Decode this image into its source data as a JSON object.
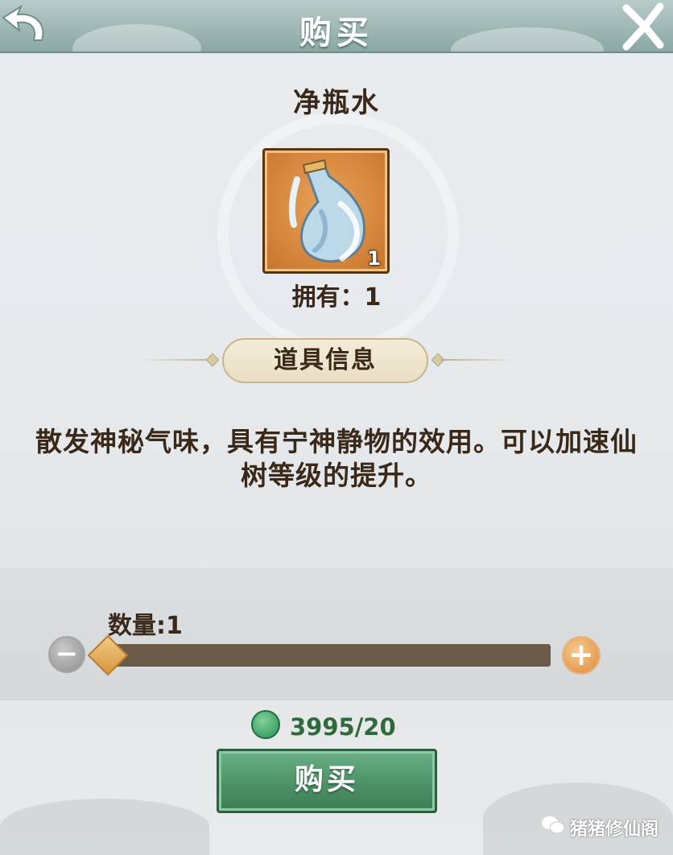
{
  "header": {
    "title": "购买"
  },
  "item": {
    "name": "净瓶水",
    "icon": "water-bottle-icon",
    "stack_count": "1",
    "owned_text": "拥有：1"
  },
  "info": {
    "section_label": "道具信息",
    "description": "散发神秘气味，具有宁神静物的效用。可以加速仙树等级的提升。"
  },
  "quantity": {
    "label": "数量:1",
    "value": 1,
    "minus_icon": "minus-icon",
    "plus_icon": "plus-icon"
  },
  "price": {
    "icon": "jade-coin-icon",
    "text": "3995/20"
  },
  "buy_button": {
    "label": "购买"
  },
  "watermark": {
    "text": "猪猪修仙阁"
  },
  "colors": {
    "header_bg": "#9fb8b6",
    "buy_button": "#4d9168",
    "price_text": "#2f6a3c",
    "slider_track": "#6b5a47",
    "plus_button": "#d98b3c"
  }
}
